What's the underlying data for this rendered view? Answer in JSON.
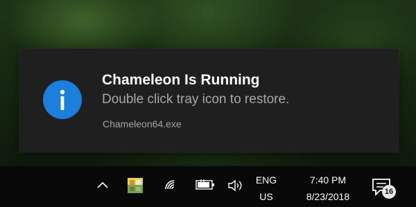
{
  "notification": {
    "title": "Chameleon Is Running",
    "message": "Double click tray icon to restore.",
    "source": "Chameleon64.exe",
    "icon": "info-icon",
    "accent_color": "#1b7fdc"
  },
  "taskbar": {
    "tray_icons": [
      "chevron-up-icon",
      "chameleon-tray-icon",
      "wifi-icon",
      "battery-icon",
      "volume-icon"
    ],
    "language": {
      "line1": "ENG",
      "line2": "US"
    },
    "clock": {
      "time": "7:40 PM",
      "date": "8/23/2018"
    },
    "action_center": {
      "icon": "action-center-icon",
      "badge": "16"
    }
  }
}
